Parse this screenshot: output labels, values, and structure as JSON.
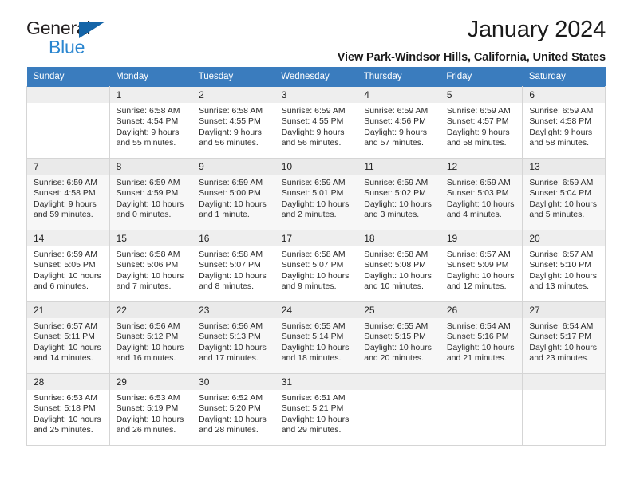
{
  "logo": {
    "line1": "General",
    "line2": "Blue",
    "triangle_color": "#1565a8",
    "text_color": "#2a86d0"
  },
  "header": {
    "title": "January 2024",
    "subtitle": "View Park-Windsor Hills, California, United States"
  },
  "theme": {
    "header_bg": "#3a7cbe",
    "header_text": "#ffffff",
    "row_alt_bg": "#f7f7f7",
    "daynum_bg": "#eeeeee",
    "grid_line": "#d5d5d5"
  },
  "calendar": {
    "weekdays": [
      "Sunday",
      "Monday",
      "Tuesday",
      "Wednesday",
      "Thursday",
      "Friday",
      "Saturday"
    ],
    "labels": {
      "sunrise": "Sunrise:",
      "sunset": "Sunset:",
      "daylight": "Daylight:"
    },
    "weeks": [
      [
        {
          "day": "",
          "empty": true
        },
        {
          "day": "1",
          "sunrise": "Sunrise: 6:58 AM",
          "sunset": "Sunset: 4:54 PM",
          "daylight1": "Daylight: 9 hours",
          "daylight2": "and 55 minutes."
        },
        {
          "day": "2",
          "sunrise": "Sunrise: 6:58 AM",
          "sunset": "Sunset: 4:55 PM",
          "daylight1": "Daylight: 9 hours",
          "daylight2": "and 56 minutes."
        },
        {
          "day": "3",
          "sunrise": "Sunrise: 6:59 AM",
          "sunset": "Sunset: 4:55 PM",
          "daylight1": "Daylight: 9 hours",
          "daylight2": "and 56 minutes."
        },
        {
          "day": "4",
          "sunrise": "Sunrise: 6:59 AM",
          "sunset": "Sunset: 4:56 PM",
          "daylight1": "Daylight: 9 hours",
          "daylight2": "and 57 minutes."
        },
        {
          "day": "5",
          "sunrise": "Sunrise: 6:59 AM",
          "sunset": "Sunset: 4:57 PM",
          "daylight1": "Daylight: 9 hours",
          "daylight2": "and 58 minutes."
        },
        {
          "day": "6",
          "sunrise": "Sunrise: 6:59 AM",
          "sunset": "Sunset: 4:58 PM",
          "daylight1": "Daylight: 9 hours",
          "daylight2": "and 58 minutes."
        }
      ],
      [
        {
          "day": "7",
          "sunrise": "Sunrise: 6:59 AM",
          "sunset": "Sunset: 4:58 PM",
          "daylight1": "Daylight: 9 hours",
          "daylight2": "and 59 minutes."
        },
        {
          "day": "8",
          "sunrise": "Sunrise: 6:59 AM",
          "sunset": "Sunset: 4:59 PM",
          "daylight1": "Daylight: 10 hours",
          "daylight2": "and 0 minutes."
        },
        {
          "day": "9",
          "sunrise": "Sunrise: 6:59 AM",
          "sunset": "Sunset: 5:00 PM",
          "daylight1": "Daylight: 10 hours",
          "daylight2": "and 1 minute."
        },
        {
          "day": "10",
          "sunrise": "Sunrise: 6:59 AM",
          "sunset": "Sunset: 5:01 PM",
          "daylight1": "Daylight: 10 hours",
          "daylight2": "and 2 minutes."
        },
        {
          "day": "11",
          "sunrise": "Sunrise: 6:59 AM",
          "sunset": "Sunset: 5:02 PM",
          "daylight1": "Daylight: 10 hours",
          "daylight2": "and 3 minutes."
        },
        {
          "day": "12",
          "sunrise": "Sunrise: 6:59 AM",
          "sunset": "Sunset: 5:03 PM",
          "daylight1": "Daylight: 10 hours",
          "daylight2": "and 4 minutes."
        },
        {
          "day": "13",
          "sunrise": "Sunrise: 6:59 AM",
          "sunset": "Sunset: 5:04 PM",
          "daylight1": "Daylight: 10 hours",
          "daylight2": "and 5 minutes."
        }
      ],
      [
        {
          "day": "14",
          "sunrise": "Sunrise: 6:59 AM",
          "sunset": "Sunset: 5:05 PM",
          "daylight1": "Daylight: 10 hours",
          "daylight2": "and 6 minutes."
        },
        {
          "day": "15",
          "sunrise": "Sunrise: 6:58 AM",
          "sunset": "Sunset: 5:06 PM",
          "daylight1": "Daylight: 10 hours",
          "daylight2": "and 7 minutes."
        },
        {
          "day": "16",
          "sunrise": "Sunrise: 6:58 AM",
          "sunset": "Sunset: 5:07 PM",
          "daylight1": "Daylight: 10 hours",
          "daylight2": "and 8 minutes."
        },
        {
          "day": "17",
          "sunrise": "Sunrise: 6:58 AM",
          "sunset": "Sunset: 5:07 PM",
          "daylight1": "Daylight: 10 hours",
          "daylight2": "and 9 minutes."
        },
        {
          "day": "18",
          "sunrise": "Sunrise: 6:58 AM",
          "sunset": "Sunset: 5:08 PM",
          "daylight1": "Daylight: 10 hours",
          "daylight2": "and 10 minutes."
        },
        {
          "day": "19",
          "sunrise": "Sunrise: 6:57 AM",
          "sunset": "Sunset: 5:09 PM",
          "daylight1": "Daylight: 10 hours",
          "daylight2": "and 12 minutes."
        },
        {
          "day": "20",
          "sunrise": "Sunrise: 6:57 AM",
          "sunset": "Sunset: 5:10 PM",
          "daylight1": "Daylight: 10 hours",
          "daylight2": "and 13 minutes."
        }
      ],
      [
        {
          "day": "21",
          "sunrise": "Sunrise: 6:57 AM",
          "sunset": "Sunset: 5:11 PM",
          "daylight1": "Daylight: 10 hours",
          "daylight2": "and 14 minutes."
        },
        {
          "day": "22",
          "sunrise": "Sunrise: 6:56 AM",
          "sunset": "Sunset: 5:12 PM",
          "daylight1": "Daylight: 10 hours",
          "daylight2": "and 16 minutes."
        },
        {
          "day": "23",
          "sunrise": "Sunrise: 6:56 AM",
          "sunset": "Sunset: 5:13 PM",
          "daylight1": "Daylight: 10 hours",
          "daylight2": "and 17 minutes."
        },
        {
          "day": "24",
          "sunrise": "Sunrise: 6:55 AM",
          "sunset": "Sunset: 5:14 PM",
          "daylight1": "Daylight: 10 hours",
          "daylight2": "and 18 minutes."
        },
        {
          "day": "25",
          "sunrise": "Sunrise: 6:55 AM",
          "sunset": "Sunset: 5:15 PM",
          "daylight1": "Daylight: 10 hours",
          "daylight2": "and 20 minutes."
        },
        {
          "day": "26",
          "sunrise": "Sunrise: 6:54 AM",
          "sunset": "Sunset: 5:16 PM",
          "daylight1": "Daylight: 10 hours",
          "daylight2": "and 21 minutes."
        },
        {
          "day": "27",
          "sunrise": "Sunrise: 6:54 AM",
          "sunset": "Sunset: 5:17 PM",
          "daylight1": "Daylight: 10 hours",
          "daylight2": "and 23 minutes."
        }
      ],
      [
        {
          "day": "28",
          "sunrise": "Sunrise: 6:53 AM",
          "sunset": "Sunset: 5:18 PM",
          "daylight1": "Daylight: 10 hours",
          "daylight2": "and 25 minutes."
        },
        {
          "day": "29",
          "sunrise": "Sunrise: 6:53 AM",
          "sunset": "Sunset: 5:19 PM",
          "daylight1": "Daylight: 10 hours",
          "daylight2": "and 26 minutes."
        },
        {
          "day": "30",
          "sunrise": "Sunrise: 6:52 AM",
          "sunset": "Sunset: 5:20 PM",
          "daylight1": "Daylight: 10 hours",
          "daylight2": "and 28 minutes."
        },
        {
          "day": "31",
          "sunrise": "Sunrise: 6:51 AM",
          "sunset": "Sunset: 5:21 PM",
          "daylight1": "Daylight: 10 hours",
          "daylight2": "and 29 minutes."
        },
        {
          "day": "",
          "empty": true
        },
        {
          "day": "",
          "empty": true
        },
        {
          "day": "",
          "empty": true
        }
      ]
    ]
  }
}
